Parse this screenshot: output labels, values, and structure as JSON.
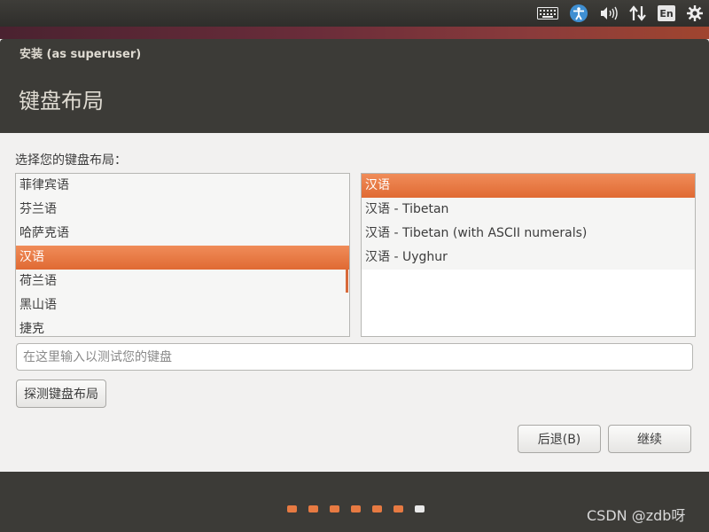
{
  "top_panel": {
    "indicators": [
      {
        "name": "keyboard-icon",
        "glyph": "⌨"
      },
      {
        "name": "accessibility-icon",
        "glyph": "♿"
      },
      {
        "name": "volume-icon",
        "glyph": "🔊"
      },
      {
        "name": "network-icon",
        "glyph": "⇅"
      },
      {
        "name": "language-indicator",
        "glyph": "En"
      },
      {
        "name": "settings-icon",
        "glyph": "⚙"
      }
    ]
  },
  "window": {
    "title": "安装 (as superuser)",
    "step_title": "键盘布局"
  },
  "main": {
    "prompt": "选择您的键盘布局：",
    "layouts": [
      {
        "label": "菲律宾语",
        "selected": false
      },
      {
        "label": "芬兰语",
        "selected": false
      },
      {
        "label": "哈萨克语",
        "selected": false
      },
      {
        "label": "汉语",
        "selected": true
      },
      {
        "label": "荷兰语",
        "selected": false
      },
      {
        "label": "黑山语",
        "selected": false
      },
      {
        "label": "捷克",
        "selected": false
      }
    ],
    "variants": [
      {
        "label": "汉语",
        "selected": true
      },
      {
        "label": "汉语 - Tibetan",
        "selected": false
      },
      {
        "label": "汉语 - Tibetan (with ASCII numerals)",
        "selected": false
      },
      {
        "label": "汉语 - Uyghur",
        "selected": false
      }
    ],
    "test_input_placeholder": "在这里输入以测试您的键盘",
    "detect_button": "探测键盘布局",
    "back_button": "后退(B)",
    "continue_button": "继续"
  },
  "progress": {
    "total_steps": 7,
    "current_step": 7
  },
  "watermark": "CSDN @zdb呀",
  "colors": {
    "accent": "#e77a42",
    "header_bg": "#3c3b37"
  }
}
